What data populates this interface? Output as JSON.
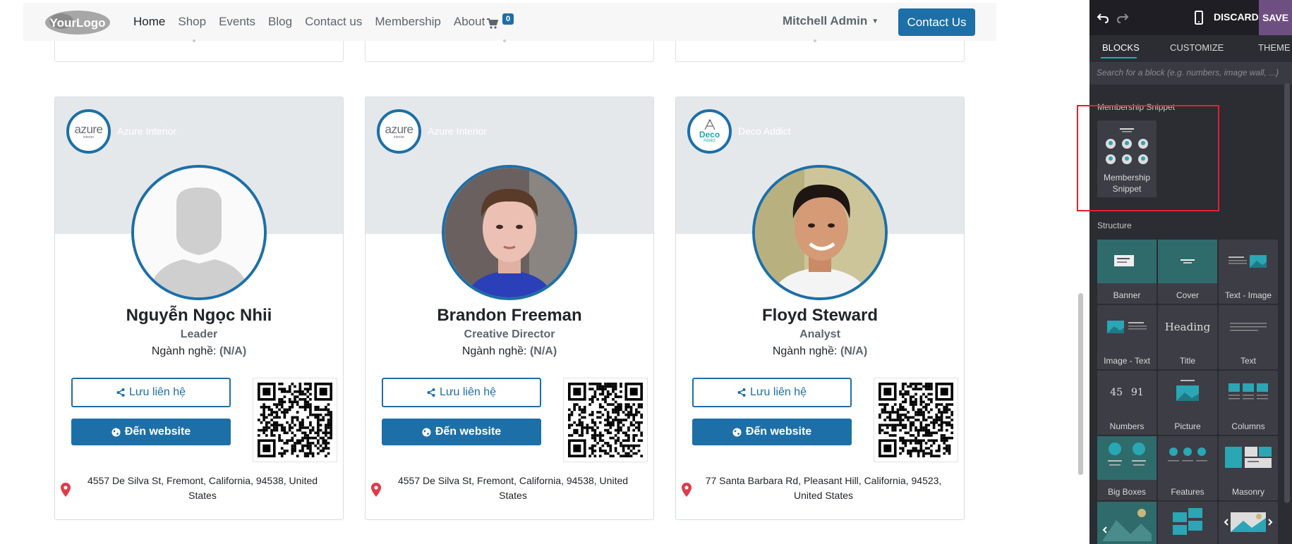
{
  "site": {
    "logo_text": "YourLogo",
    "nav": [
      "Home",
      "Shop",
      "Events",
      "Blog",
      "Contact us",
      "Membership",
      "About"
    ],
    "cart_count": "0",
    "user_name": "Mitchell Admin",
    "contact_button": "Contact Us"
  },
  "members": [
    {
      "company": "Azure Interior",
      "company_logo": {
        "main": "azure",
        "sub": "interior"
      },
      "name": "Nguyễn Ngọc Nhii",
      "role": "Leader",
      "industry_label": "Ngành nghề:",
      "industry_value": "(N/A)",
      "save_label": "Lưu liên hệ",
      "website_label": "Đến website",
      "address": "4557 De Silva St, Fremont, California, 94538, United States",
      "avatar": "placeholder"
    },
    {
      "company": "Azure Interior",
      "company_logo": {
        "main": "azure",
        "sub": "interior"
      },
      "name": "Brandon Freeman",
      "role": "Creative Director",
      "industry_label": "Ngành nghề:",
      "industry_value": "(N/A)",
      "save_label": "Lưu liên hệ",
      "website_label": "Đến website",
      "address": "4557 De Silva St, Fremont, California, 94538, United States",
      "avatar": "photo"
    },
    {
      "company": "Deco Addict",
      "company_logo": {
        "main": "Deco",
        "sub": "Addict"
      },
      "name": "Floyd Steward",
      "role": "Analyst",
      "industry_label": "Ngành nghề:",
      "industry_value": "(N/A)",
      "save_label": "Lưu liên hệ",
      "website_label": "Đến website",
      "address": "77 Santa Barbara Rd, Pleasant Hill, California, 94523, United States",
      "avatar": "photo"
    }
  ],
  "editor": {
    "discard": "DISCARD",
    "save": "SAVE",
    "tabs": [
      "BLOCKS",
      "CUSTOMIZE",
      "THEME"
    ],
    "search_placeholder": "Search for a block (e.g. numbers, image wall, ...)",
    "membership_section": "Membership Snippet",
    "membership_tile": [
      "Membership",
      "Snippet"
    ],
    "structure_section": "Structure",
    "structure_blocks": [
      "Banner",
      "Cover",
      "Text - Image",
      "Image - Text",
      "Title",
      "Text",
      "Numbers",
      "Picture",
      "Columns",
      "Big Boxes",
      "Features",
      "Masonry"
    ],
    "title_thumb_text": "Heading",
    "numbers_thumb": [
      "45",
      "91"
    ],
    "colors": {
      "panel": "#2c2c33",
      "accent": "#2aa6b5",
      "save": "#6e4f82",
      "highlight": "#e5212a"
    }
  },
  "colors": {
    "primary": "#1d6fa8",
    "banner": "#e5e8eb"
  }
}
